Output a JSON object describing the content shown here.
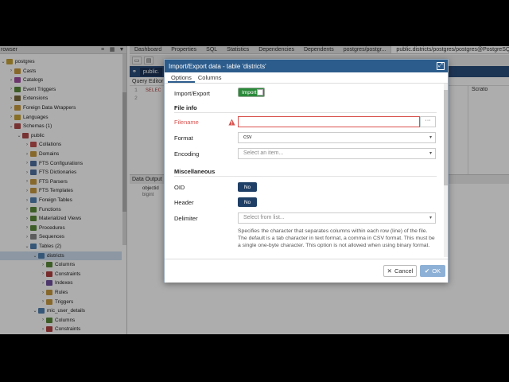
{
  "browser": {
    "title": "rowser",
    "tree": [
      {
        "label": "postgres",
        "depth": 0,
        "icon": "database-icon",
        "chevron": "down",
        "color": "#c8a23a"
      },
      {
        "label": "Casts",
        "depth": 1,
        "icon": "casts-icon",
        "chevron": "right",
        "color": "#c89a40"
      },
      {
        "label": "Catalogs",
        "depth": 1,
        "icon": "catalog-icon",
        "chevron": "right",
        "color": "#a050a0"
      },
      {
        "label": "Event Triggers",
        "depth": 1,
        "icon": "event-trigger-icon",
        "chevron": "right",
        "color": "#5a8a3a"
      },
      {
        "label": "Extensions",
        "depth": 1,
        "icon": "extension-icon",
        "chevron": "right",
        "color": "#7a6a3a"
      },
      {
        "label": "Foreign Data Wrappers",
        "depth": 1,
        "icon": "fdw-icon",
        "chevron": "right",
        "color": "#c89a40"
      },
      {
        "label": "Languages",
        "depth": 1,
        "icon": "language-icon",
        "chevron": "right",
        "color": "#c8a23a"
      },
      {
        "label": "Schemas (1)",
        "depth": 1,
        "icon": "schema-icon",
        "chevron": "down",
        "color": "#b04a4a"
      },
      {
        "label": "public",
        "depth": 2,
        "icon": "schema-icon",
        "chevron": "down",
        "color": "#b04a4a"
      },
      {
        "label": "Collations",
        "depth": 3,
        "icon": "collation-icon",
        "chevron": "right",
        "color": "#c05050"
      },
      {
        "label": "Domains",
        "depth": 3,
        "icon": "domain-icon",
        "chevron": "right",
        "color": "#c89a40"
      },
      {
        "label": "FTS Configurations",
        "depth": 3,
        "icon": "fts-config-icon",
        "chevron": "right",
        "color": "#5070a0"
      },
      {
        "label": "FTS Dictionaries",
        "depth": 3,
        "icon": "fts-dict-icon",
        "chevron": "right",
        "color": "#5070a0"
      },
      {
        "label": "FTS Parsers",
        "depth": 3,
        "icon": "fts-parser-icon",
        "chevron": "right",
        "color": "#c89a40"
      },
      {
        "label": "FTS Templates",
        "depth": 3,
        "icon": "fts-template-icon",
        "chevron": "right",
        "color": "#c89a40"
      },
      {
        "label": "Foreign Tables",
        "depth": 3,
        "icon": "foreign-table-icon",
        "chevron": "right",
        "color": "#5080b0"
      },
      {
        "label": "Functions",
        "depth": 3,
        "icon": "function-icon",
        "chevron": "right",
        "color": "#5a8a3a"
      },
      {
        "label": "Materialized Views",
        "depth": 3,
        "icon": "mat-view-icon",
        "chevron": "right",
        "color": "#5a8a3a"
      },
      {
        "label": "Procedures",
        "depth": 3,
        "icon": "procedure-icon",
        "chevron": "right",
        "color": "#5a8a3a"
      },
      {
        "label": "Sequences",
        "depth": 3,
        "icon": "sequence-icon",
        "chevron": "right",
        "color": "#888888"
      },
      {
        "label": "Tables (2)",
        "depth": 3,
        "icon": "table-icon",
        "chevron": "down",
        "color": "#5080b0"
      },
      {
        "label": "districts",
        "depth": 4,
        "icon": "table-icon",
        "chevron": "down",
        "color": "#5080b0",
        "selected": true
      },
      {
        "label": "Columns",
        "depth": 5,
        "icon": "columns-icon",
        "chevron": "right",
        "color": "#5a8a3a"
      },
      {
        "label": "Constraints",
        "depth": 5,
        "icon": "constraint-icon",
        "chevron": "right",
        "color": "#b04040"
      },
      {
        "label": "Indexes",
        "depth": 5,
        "icon": "index-icon",
        "chevron": "right",
        "color": "#7050a0"
      },
      {
        "label": "Rules",
        "depth": 5,
        "icon": "rule-icon",
        "chevron": "right",
        "color": "#c89a40"
      },
      {
        "label": "Triggers",
        "depth": 5,
        "icon": "trigger-icon",
        "chevron": "right",
        "color": "#c89a40"
      },
      {
        "label": "mic_user_details",
        "depth": 4,
        "icon": "table-icon",
        "chevron": "down",
        "color": "#5080b0"
      },
      {
        "label": "Columns",
        "depth": 5,
        "icon": "columns-icon",
        "chevron": "right",
        "color": "#5a8a3a"
      },
      {
        "label": "Constraints",
        "depth": 5,
        "icon": "constraint-icon",
        "chevron": "right",
        "color": "#b04040"
      }
    ]
  },
  "tabs": [
    "Dashboard",
    "Properties",
    "SQL",
    "Statistics",
    "Dependencies",
    "Dependents",
    "postgres/postgr...",
    "public.districts/postgres/postgres@PostgreSQL"
  ],
  "query": {
    "conn_label": "public.",
    "panel_label": "Query Editor",
    "line1": "1",
    "line2": "2",
    "code1": "SELEC",
    "scratch": "Scrato",
    "output_tab": "Data Output",
    "column_name": "objectid",
    "column_type": "bigint"
  },
  "dialog": {
    "title": "Import/Export data - table 'districts'",
    "tabs": [
      "Options",
      "Columns"
    ],
    "import_export_label": "Import/Export",
    "import_toggle": "Import",
    "file_info_title": "File info",
    "filename_label": "Filename",
    "filename_value": "",
    "more_button": "···",
    "format_label": "Format",
    "format_value": "csv",
    "encoding_label": "Encoding",
    "encoding_placeholder": "Select an item...",
    "misc_title": "Miscellaneous",
    "oid_label": "OID",
    "oid_value": "No",
    "header_label": "Header",
    "header_value": "No",
    "delimiter_label": "Delimiter",
    "delimiter_placeholder": "Select from list...",
    "delimiter_help": "Specifies the character that separates columns within each row (line) of the file. The default is a tab character in text format, a comma in CSV format. This must be a single one-byte character. This option is not allowed when using binary format.",
    "cancel_label": "Cancel",
    "ok_label": "OK"
  },
  "colors": {
    "title_bar": "#2c5c8c",
    "toggle_green": "#2a8a3a",
    "toggle_dark": "#1f3f66",
    "error": "#d9534f",
    "ok_disabled": "#8db0d6"
  }
}
